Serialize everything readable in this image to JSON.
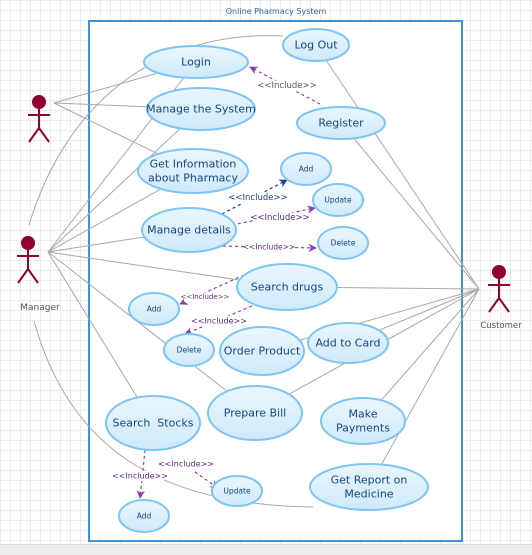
{
  "system": {
    "title": "Online Pharmacy System",
    "border_color": "#3d92d8"
  },
  "colors": {
    "usecase_fill_top": "#e9f6fd",
    "usecase_fill_bottom": "#cfeafb",
    "usecase_border": "#7ec5f3",
    "usecase_text": "#16467f",
    "actor": "#8f0034",
    "association": "#a8a8a8",
    "include_purple": "#8a3cb0",
    "include_navy": "#1d3f8f"
  },
  "actors": [
    {
      "id": "admin",
      "label": ""
    },
    {
      "id": "manager",
      "label": "Manager"
    },
    {
      "id": "customer",
      "label": "Customer"
    }
  ],
  "use_cases": [
    {
      "id": "logout",
      "lines": [
        "Log Out"
      ]
    },
    {
      "id": "login",
      "lines": [
        "Login"
      ]
    },
    {
      "id": "manage_system",
      "lines": [
        "Manage the System"
      ]
    },
    {
      "id": "register",
      "lines": [
        "Register"
      ]
    },
    {
      "id": "get_info",
      "lines": [
        "Get Information",
        "about Pharmacy"
      ]
    },
    {
      "id": "md_add",
      "lines": [
        "Add"
      ]
    },
    {
      "id": "md_update",
      "lines": [
        "Update"
      ]
    },
    {
      "id": "manage_details",
      "lines": [
        "Manage details"
      ]
    },
    {
      "id": "md_delete",
      "lines": [
        "Delete"
      ]
    },
    {
      "id": "search_drugs",
      "lines": [
        "Search drugs"
      ]
    },
    {
      "id": "sd_add",
      "lines": [
        "Add"
      ]
    },
    {
      "id": "sd_delete",
      "lines": [
        "Delete"
      ]
    },
    {
      "id": "order_product",
      "lines": [
        "Order Product"
      ]
    },
    {
      "id": "add_to_card",
      "lines": [
        "Add to Card"
      ]
    },
    {
      "id": "prepare_bill",
      "lines": [
        "Prepare Bill"
      ]
    },
    {
      "id": "search_stocks",
      "lines": [
        "Search  Stocks"
      ]
    },
    {
      "id": "make_payments",
      "lines": [
        "Make",
        "Payments"
      ]
    },
    {
      "id": "ss_update",
      "lines": [
        "Update"
      ]
    },
    {
      "id": "get_report",
      "lines": [
        "Get Report on",
        "Medicine"
      ]
    },
    {
      "id": "ss_add",
      "lines": [
        "Add"
      ]
    }
  ],
  "associations": [
    {
      "actor": "admin",
      "use_case": "login"
    },
    {
      "actor": "admin",
      "use_case": "manage_system"
    },
    {
      "actor": "admin",
      "use_case": "get_info"
    },
    {
      "actor": "manager",
      "use_case": "logout"
    },
    {
      "actor": "manager",
      "use_case": "login"
    },
    {
      "actor": "manager",
      "use_case": "manage_system"
    },
    {
      "actor": "manager",
      "use_case": "get_info"
    },
    {
      "actor": "manager",
      "use_case": "manage_details"
    },
    {
      "actor": "manager",
      "use_case": "search_drugs"
    },
    {
      "actor": "manager",
      "use_case": "prepare_bill"
    },
    {
      "actor": "manager",
      "use_case": "search_stocks"
    },
    {
      "actor": "manager",
      "use_case": "get_report"
    },
    {
      "actor": "customer",
      "use_case": "logout"
    },
    {
      "actor": "customer",
      "use_case": "register"
    },
    {
      "actor": "customer",
      "use_case": "search_drugs"
    },
    {
      "actor": "customer",
      "use_case": "order_product"
    },
    {
      "actor": "customer",
      "use_case": "add_to_card"
    },
    {
      "actor": "customer",
      "use_case": "prepare_bill"
    },
    {
      "actor": "customer",
      "use_case": "make_payments"
    },
    {
      "actor": "customer",
      "use_case": "get_report"
    }
  ],
  "includes": [
    {
      "from": "register",
      "to": "login",
      "label": "<<Include>>",
      "color": "purple"
    },
    {
      "from": "manage_details",
      "to": "md_add",
      "label": "<<Include>>",
      "color": "navy"
    },
    {
      "from": "manage_details",
      "to": "md_update",
      "label": "<<Include>>",
      "color": "purple"
    },
    {
      "from": "manage_details",
      "to": "md_delete",
      "label": "<<Include>>",
      "color": "purple"
    },
    {
      "from": "search_drugs",
      "to": "sd_add",
      "label": "<<Include>>",
      "color": "purple"
    },
    {
      "from": "search_drugs",
      "to": "sd_delete",
      "label": "<<Include>>",
      "color": "purple"
    },
    {
      "from": "search_stocks",
      "to": "ss_add",
      "label": "<<Include>>",
      "color": "purple"
    },
    {
      "from": "search_stocks",
      "to": "ss_update",
      "label": "<<Include>>",
      "color": "purple"
    }
  ]
}
